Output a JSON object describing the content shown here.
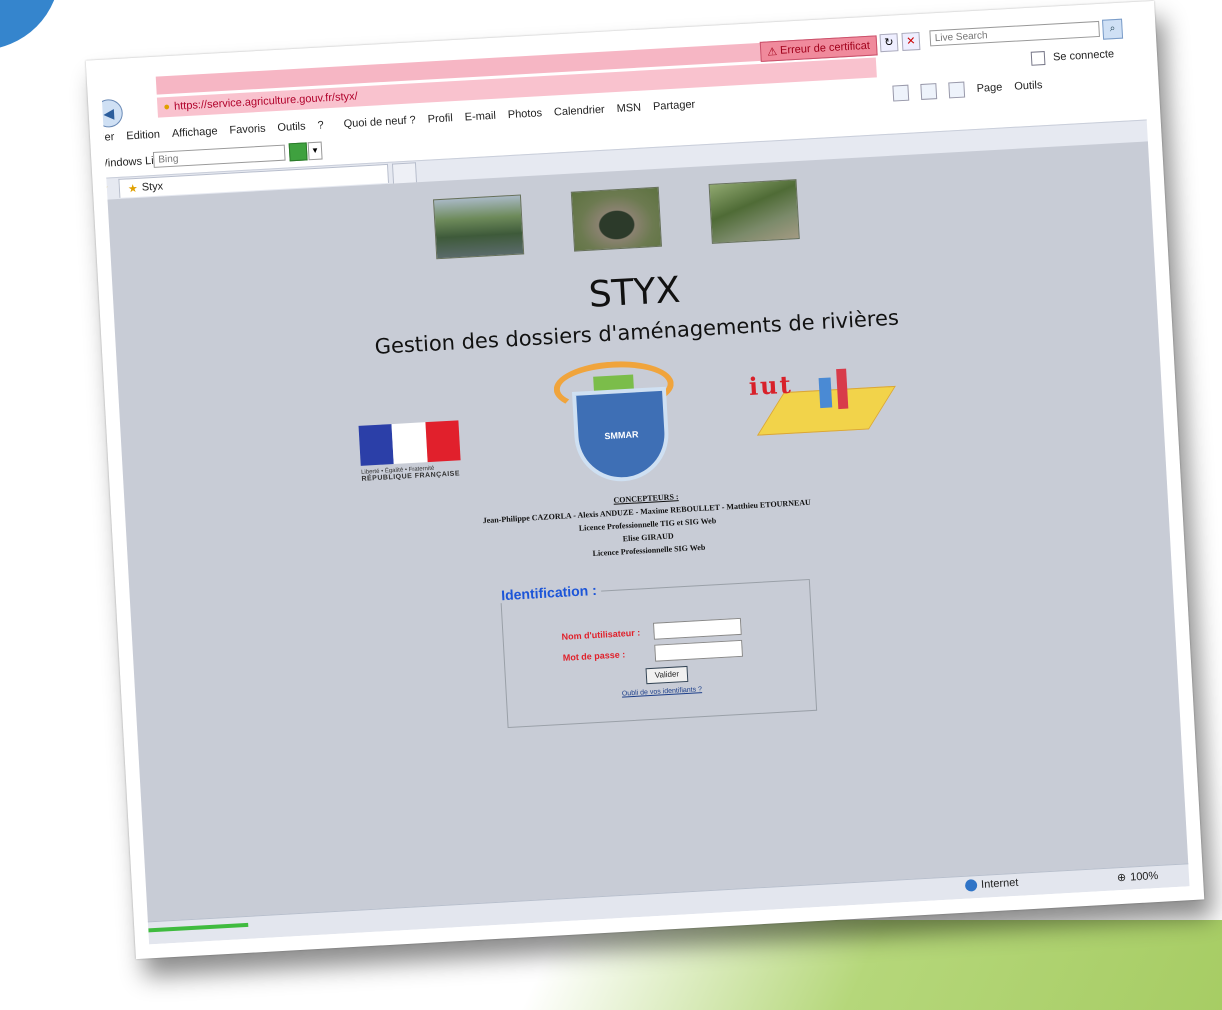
{
  "browser": {
    "url": "https://service.agriculture.gouv.fr/styx/",
    "cert_error": "Erreur de certificat",
    "live_search_placeholder": "Live Search",
    "se_connecter": "Se connecte",
    "menu": [
      "hier",
      "Edition",
      "Affichage",
      "Favoris",
      "Outils",
      "?"
    ],
    "links": [
      "Quoi de neuf ?",
      "Profil",
      "E-mail",
      "Photos",
      "Calendrier",
      "MSN",
      "Partager"
    ],
    "right_tools": {
      "page": "Page",
      "outils": "Outils"
    },
    "windows_live_label": "Windows Live",
    "bing_placeholder": "Bing",
    "tab_title": "Styx",
    "status": {
      "zone": "Internet",
      "zoom": "100%"
    }
  },
  "page": {
    "title": "STYX",
    "subtitle": "Gestion des dossiers d'aménagements de rivières",
    "logos": {
      "rf_motto": "Liberté • Égalité • Fraternité",
      "rf_name": "RÉPUBLIQUE FRANÇAISE",
      "smmar": "SMMAR",
      "iut": "iut"
    },
    "credits": {
      "heading": "CONCEPTEURS :",
      "line1": "Jean-Philippe CAZORLA - Alexis ANDUZE - Maxime REBOULLET - Matthieu ETOURNEAU",
      "line2": "Licence Professionnelle TIG et SIG Web",
      "line3": "Elise GIRAUD",
      "line4": "Licence Professionnelle SIG Web"
    },
    "login": {
      "legend": "Identification :",
      "username_label": "Nom d'utilisateur :",
      "password_label": "Mot de passe :",
      "submit": "Valider",
      "forgot": "Oubli de vos identifiants ?"
    }
  },
  "colors": {
    "page_bg": "#c8ccd6",
    "cert_bar": "#f6b6c4",
    "legend_blue": "#1c55d8",
    "label_red": "#e0202a"
  }
}
